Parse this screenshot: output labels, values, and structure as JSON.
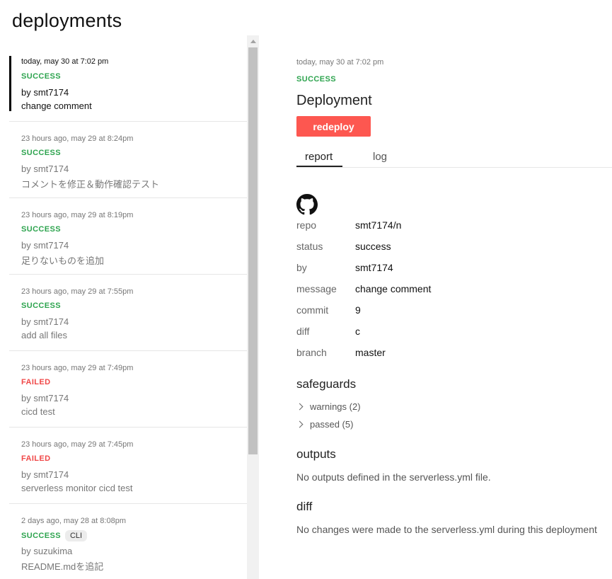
{
  "page_title": "deployments",
  "deployments": [
    {
      "when": "today, may 30 at 7:02 pm",
      "status": "SUCCESS",
      "by": "by smt7174",
      "message": "change comment"
    },
    {
      "when": "23 hours ago, may 29 at 8:24pm",
      "status": "SUCCESS",
      "by": "by smt7174",
      "message": "コメントを修正＆動作確認テスト"
    },
    {
      "when": "23 hours ago, may 29 at 8:19pm",
      "status": "SUCCESS",
      "by": "by smt7174",
      "message": "足りないものを追加"
    },
    {
      "when": "23 hours ago, may 29 at 7:55pm",
      "status": "SUCCESS",
      "by": "by smt7174",
      "message": "add all files"
    },
    {
      "when": "23 hours ago, may 29 at 7:49pm",
      "status": "FAILED",
      "by": "by smt7174",
      "message": "cicd test"
    },
    {
      "when": "23 hours ago, may 29 at 7:45pm",
      "status": "FAILED",
      "by": "by smt7174",
      "message": "serverless monitor cicd test"
    },
    {
      "when": "2 days ago, may 28 at 8:08pm",
      "status": "SUCCESS",
      "badge": "CLI",
      "by": "by suzukima",
      "message": "README.mdを追記"
    }
  ],
  "detail": {
    "when": "today, may 30 at 7:02 pm",
    "status": "SUCCESS",
    "title": "Deployment",
    "redeploy_label": "redeploy",
    "tabs": {
      "report": "report",
      "log": "log"
    },
    "report": [
      {
        "key": "repo",
        "value": "smt7174/n"
      },
      {
        "key": "status",
        "value": "success"
      },
      {
        "key": "by",
        "value": "smt7174"
      },
      {
        "key": "message",
        "value": "change comment"
      },
      {
        "key": "commit",
        "value": "9"
      },
      {
        "key": "diff",
        "value": "c"
      },
      {
        "key": "branch",
        "value": "master"
      }
    ],
    "safeguards": {
      "heading": "safeguards",
      "warnings": "warnings (2)",
      "passed": "passed (5)"
    },
    "outputs": {
      "heading": "outputs",
      "text": "No outputs defined in the serverless.yml file."
    },
    "diff": {
      "heading": "diff",
      "text": "No changes were made to the serverless.yml during this deployment"
    }
  },
  "colors": {
    "success": "#2ea44f",
    "failed": "#f04848",
    "accent": "#fd5750"
  },
  "icons": {
    "repo": "github-icon",
    "expand": "chevron-right-icon"
  }
}
